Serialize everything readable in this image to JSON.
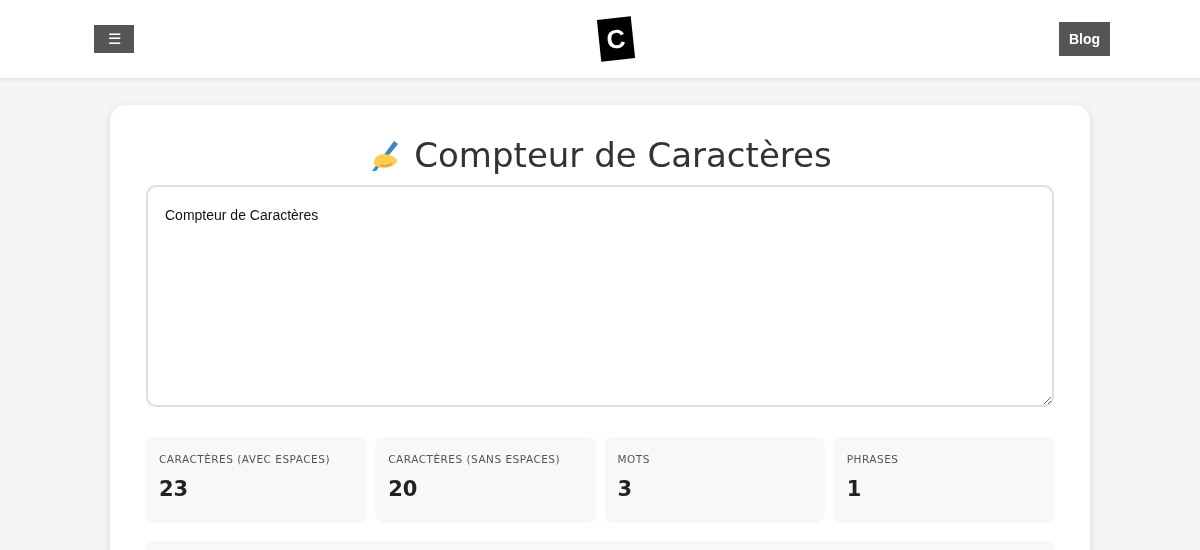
{
  "header": {
    "menu_button": "☰",
    "logo": "C",
    "blog_button": "Blog"
  },
  "title": "Compteur de Caractères",
  "textarea": {
    "value": "Compteur de Caractères"
  },
  "stats": [
    {
      "label": "CARACTÈRES (AVEC ESPACES)",
      "value": "23"
    },
    {
      "label": "CARACTÈRES (SANS ESPACES)",
      "value": "20"
    },
    {
      "label": "MOTS",
      "value": "3"
    },
    {
      "label": "PHRASES",
      "value": "1"
    }
  ]
}
